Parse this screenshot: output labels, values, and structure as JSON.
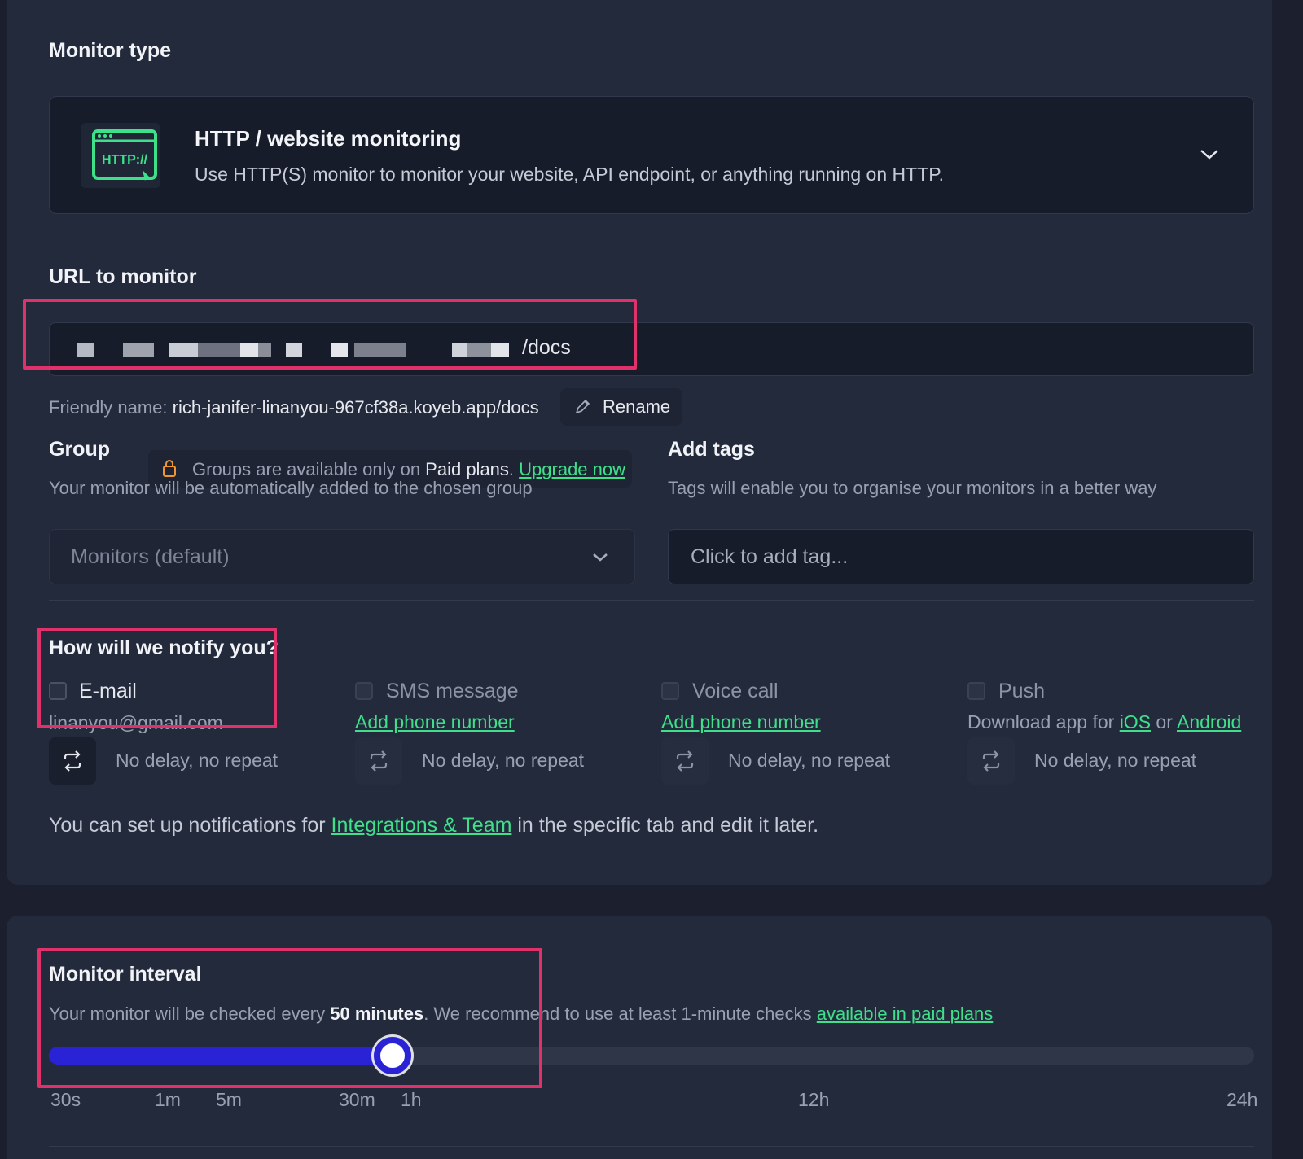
{
  "monitor_type": {
    "heading": "Monitor type",
    "icon_text": "HTTP://",
    "title": "HTTP / website monitoring",
    "description": "Use HTTP(S) monitor to monitor your website, API endpoint, or anything running on HTTP."
  },
  "url": {
    "heading": "URL to monitor",
    "value_suffix": "/docs",
    "friendly_label": "Friendly name: ",
    "friendly_value": "rich-janifer-linanyou-967cf38a.koyeb.app/docs",
    "rename_label": "Rename"
  },
  "group": {
    "heading": "Group",
    "badge_text_1": "Groups are available only on ",
    "badge_text_2": "Paid plans",
    "badge_text_3": ". ",
    "upgrade_link": "Upgrade now",
    "description": "Your monitor will be automatically added to the chosen group",
    "selected": "Monitors (default)"
  },
  "tags": {
    "heading": "Add tags",
    "description": "Tags will enable you to organise your monitors in a better way",
    "placeholder": "Click to add tag..."
  },
  "notify": {
    "heading": "How will we notify you?",
    "email": {
      "label": "E-mail",
      "detail": "linanyou@gmail.com",
      "repeat": "No delay, no repeat"
    },
    "sms": {
      "label": "SMS message",
      "link": "Add phone number",
      "repeat": "No delay, no repeat"
    },
    "voice": {
      "label": "Voice call",
      "link": "Add phone number",
      "repeat": "No delay, no repeat"
    },
    "push": {
      "label": "Push",
      "text_1": "Download app for ",
      "ios": "iOS",
      "text_2": " or ",
      "android": "Android",
      "repeat": "No delay, no repeat"
    },
    "footer_1": "You can set up notifications for ",
    "footer_link": "Integrations & Team",
    "footer_2": " in the specific tab and edit it later."
  },
  "interval": {
    "heading": "Monitor interval",
    "desc_1": "Your monitor will be checked every ",
    "desc_bold": "50 minutes",
    "desc_2": ". We recommend to use at least 1-minute checks ",
    "desc_link": "available in paid plans",
    "slider_fraction": 0.285,
    "ticks": [
      "30s",
      "1m",
      "5m",
      "30m",
      "1h",
      "12h",
      "24h"
    ]
  },
  "colors": {
    "accent_green": "#3ee08a",
    "slider_blue": "#2a23d6",
    "highlight": "#e0316b"
  }
}
